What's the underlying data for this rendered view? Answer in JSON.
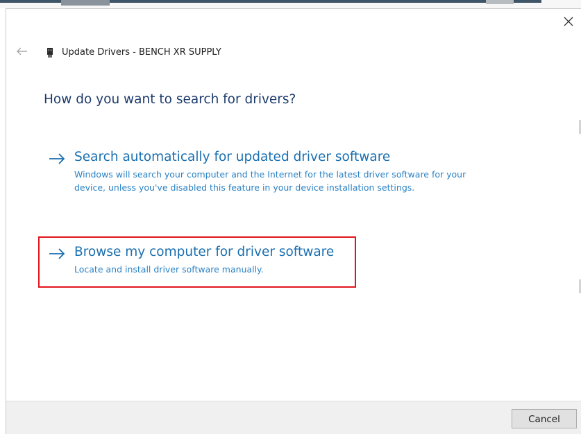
{
  "window": {
    "title": "Update Drivers - BENCH XR SUPPLY",
    "close_glyph": "✕",
    "back_glyph": "←",
    "device_icon": "usb-device-icon"
  },
  "main": {
    "question": "How do you want to search for drivers?",
    "options": [
      {
        "title": "Search automatically for updated driver software",
        "description": "Windows will search your computer and the Internet for the latest driver software for your device, unless you've disabled this feature in your device installation settings."
      },
      {
        "title": "Browse my computer for driver software",
        "description": "Locate and install driver software manually.",
        "highlighted": true
      }
    ]
  },
  "footer": {
    "cancel_label": "Cancel"
  },
  "colors": {
    "link_title": "#1a6fb0",
    "link_desc": "#2a82c4",
    "question": "#1c3a6b",
    "highlight": "#e0151b",
    "footer_bg": "#f0f0f0"
  }
}
